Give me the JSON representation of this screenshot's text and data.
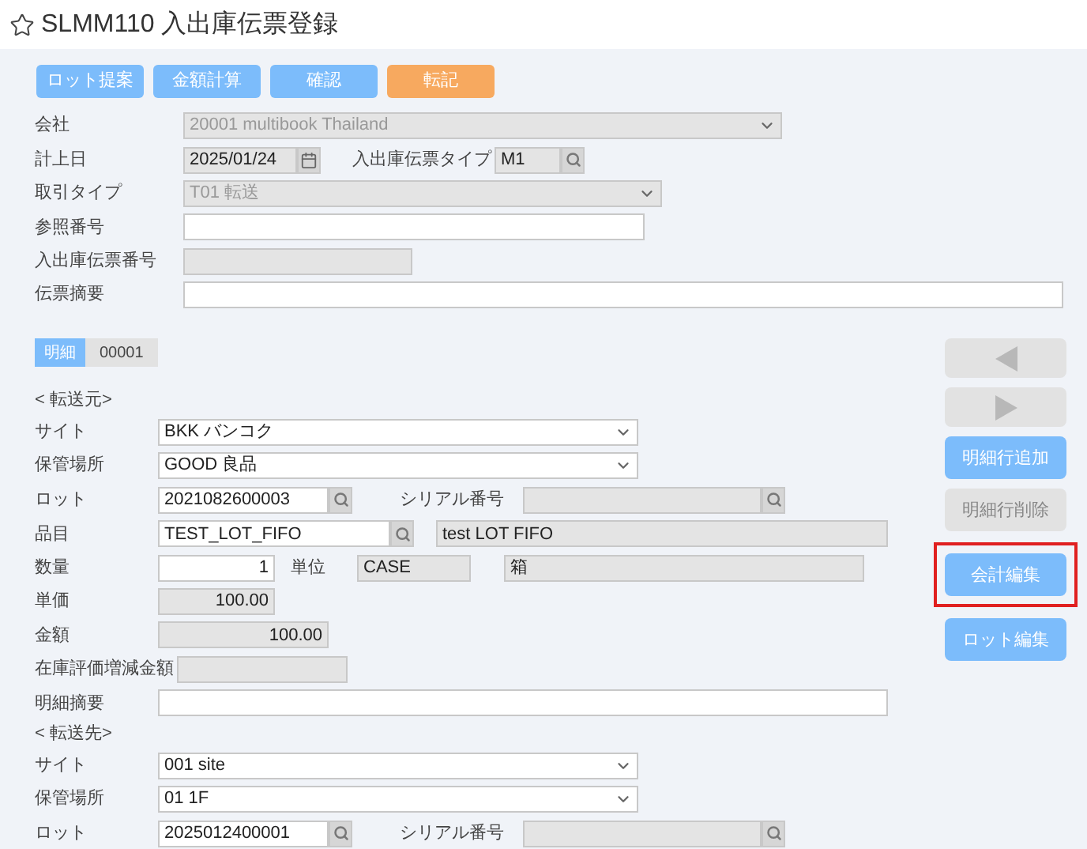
{
  "title": "SLMM110 入出庫伝票登録",
  "toolbar": [
    {
      "label": "ロット提案",
      "kind": "primary"
    },
    {
      "label": "金額計算",
      "kind": "primary"
    },
    {
      "label": "確認",
      "kind": "primary"
    },
    {
      "label": "転記",
      "kind": "accent"
    }
  ],
  "header": {
    "company": {
      "label": "会社",
      "value": "20001 multibook Thailand",
      "disabled": true
    },
    "posting_date": {
      "label": "計上日",
      "value": "2025/01/24",
      "readonly": true
    },
    "slip_type": {
      "label": "入出庫伝票タイプ",
      "value": "M1",
      "readonly": true
    },
    "transaction_type": {
      "label": "取引タイプ",
      "value": "T01 転送",
      "disabled": true
    },
    "reference_no": {
      "label": "参照番号"
    },
    "slip_no": {
      "label": "入出庫伝票番号",
      "readonly": true
    },
    "memo": {
      "label": "伝票摘要"
    }
  },
  "detail_tab": {
    "label": "明細",
    "number": "00001",
    "selected": true
  },
  "source": {
    "heading": "< 転送元>",
    "site": {
      "label": "サイト",
      "value": "BKK バンコク"
    },
    "location": {
      "label": "保管場所",
      "value": "GOOD 良品"
    },
    "lot": {
      "label": "ロット",
      "value": "2021082600003"
    },
    "serial": {
      "label": "シリアル番号",
      "readonly": true
    },
    "item": {
      "label": "品目",
      "value": "TEST_LOT_FIFO"
    },
    "item_name": {
      "value": "test LOT FIFO",
      "readonly": true
    },
    "quantity": {
      "label": "数量",
      "value": "1"
    },
    "unit": {
      "label": "単位",
      "value": "CASE",
      "readonly": true
    },
    "unit_name": {
      "value": "箱",
      "readonly": true
    },
    "unit_price": {
      "label": "単価",
      "value": "100.00",
      "readonly": true
    },
    "amount": {
      "label": "金額",
      "value": "100.00",
      "readonly": true
    },
    "valuation": {
      "label": "在庫評価増減金額",
      "readonly": true
    },
    "line_memo": {
      "label": "明細摘要"
    }
  },
  "destination": {
    "heading": "< 転送先>",
    "site": {
      "label": "サイト",
      "value": "001 site"
    },
    "location": {
      "label": "保管場所",
      "value": "01 1F"
    },
    "lot": {
      "label": "ロット",
      "value": "2025012400001"
    },
    "serial": {
      "label": "シリアル番号",
      "readonly": true
    }
  },
  "side_buttons": [
    {
      "kind": "prev",
      "disabled": true,
      "highlighted": false
    },
    {
      "kind": "next",
      "disabled": true,
      "highlighted": false
    },
    {
      "kind": "text",
      "label": "明細行追加",
      "disabled": false,
      "highlighted": false
    },
    {
      "kind": "text",
      "label": "明細行削除",
      "disabled": true,
      "highlighted": false
    },
    {
      "kind": "text",
      "label": "会計編集",
      "disabled": false,
      "highlighted": true
    },
    {
      "kind": "text",
      "label": "ロット編集",
      "disabled": false,
      "highlighted": false
    }
  ]
}
